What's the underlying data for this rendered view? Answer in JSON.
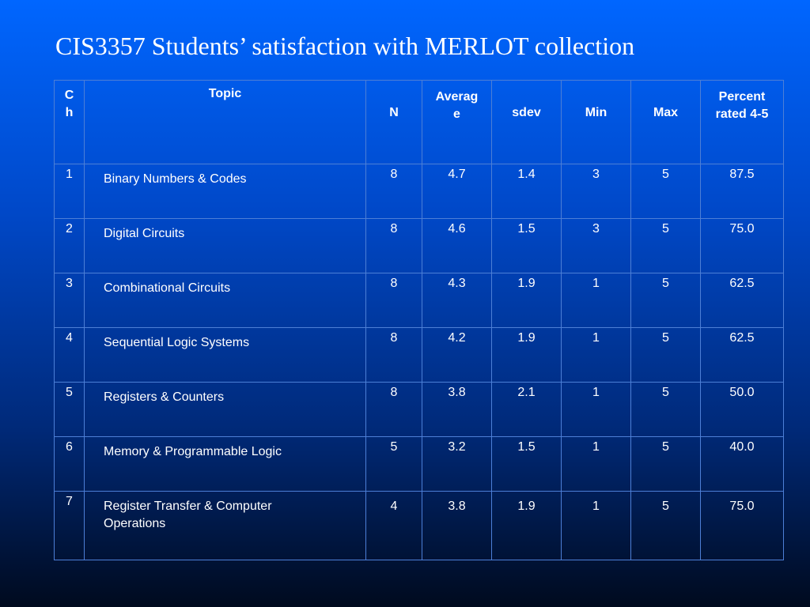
{
  "title": "CIS3357 Students’ satisfaction with MERLOT collection",
  "table": {
    "headers": {
      "ch": "C\nh",
      "topic": "Topic",
      "n": "N",
      "average": "Averag\ne",
      "sdev": "sdev",
      "min": "Min",
      "max": "Max",
      "percent": "Percent\nrated 4-5"
    },
    "rows": [
      {
        "ch": "1",
        "topic": "Binary Numbers & Codes",
        "n": "8",
        "average": "4.7",
        "sdev": "1.4",
        "min": "3",
        "max": "5",
        "percent": "87.5"
      },
      {
        "ch": "2",
        "topic": "Digital Circuits",
        "n": "8",
        "average": "4.6",
        "sdev": "1.5",
        "min": "3",
        "max": "5",
        "percent": "75.0"
      },
      {
        "ch": "3",
        "topic": "Combinational Circuits",
        "n": "8",
        "average": "4.3",
        "sdev": "1.9",
        "min": "1",
        "max": "5",
        "percent": "62.5"
      },
      {
        "ch": "4",
        "topic": "Sequential Logic Systems",
        "n": "8",
        "average": "4.2",
        "sdev": "1.9",
        "min": "1",
        "max": "5",
        "percent": "62.5"
      },
      {
        "ch": "5",
        "topic": "Registers & Counters",
        "n": "8",
        "average": "3.8",
        "sdev": "2.1",
        "min": "1",
        "max": "5",
        "percent": "50.0"
      },
      {
        "ch": "6",
        "topic": "Memory & Programmable Logic",
        "n": "5",
        "average": "3.2",
        "sdev": "1.5",
        "min": "1",
        "max": "5",
        "percent": "40.0"
      },
      {
        "ch": "7",
        "topic": "Register Transfer & Computer Operations",
        "n": "4",
        "average": "3.8",
        "sdev": "1.9",
        "min": "1",
        "max": "5",
        "percent": "75.0"
      }
    ]
  },
  "colors": {
    "background_top": "#0066ff",
    "background_bottom": "#000a1e",
    "text": "#ffffff",
    "grid_line": "#4d7fd6"
  }
}
